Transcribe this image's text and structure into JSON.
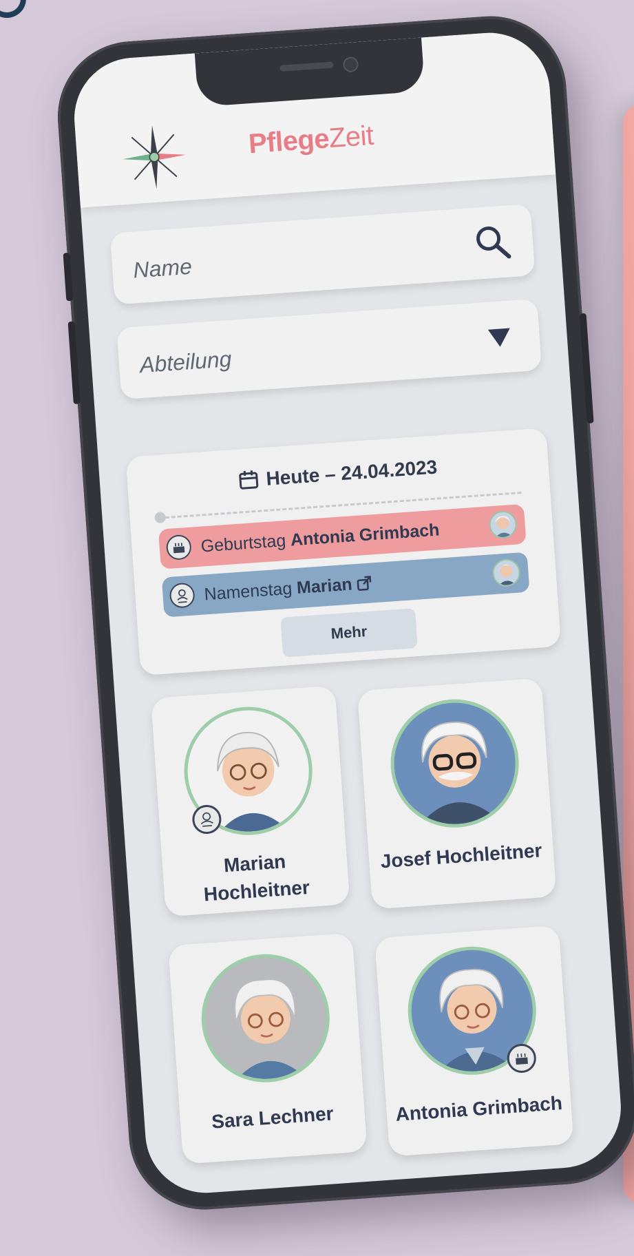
{
  "app": {
    "brand_part1": "Pflege",
    "brand_part2": "Zeit",
    "brand_color": "#e77d87"
  },
  "search": {
    "placeholder": "Name",
    "icon": "search-icon"
  },
  "department": {
    "placeholder": "Abteilung",
    "icon": "caret-down-icon"
  },
  "today": {
    "label": "Heute – 24.04.2023",
    "events": [
      {
        "type_label": "Geburtstag",
        "name": "Antonia Grimbach",
        "icon": "birthday-cake-icon",
        "color": "#ef9c9f"
      },
      {
        "type_label": "Namenstag",
        "name": "Marian",
        "icon": "person-badge-icon",
        "link_icon": "external-link-icon",
        "color": "#87a7c5"
      }
    ],
    "more_label": "Mehr"
  },
  "residents": [
    {
      "name": "Marian Hochleitner",
      "badge": "person-badge-icon"
    },
    {
      "name": "Josef Hochleitner"
    },
    {
      "name": "Sara Lechner"
    },
    {
      "name": "Antonia Grimbach",
      "badge": "birthday-cake-icon"
    }
  ]
}
